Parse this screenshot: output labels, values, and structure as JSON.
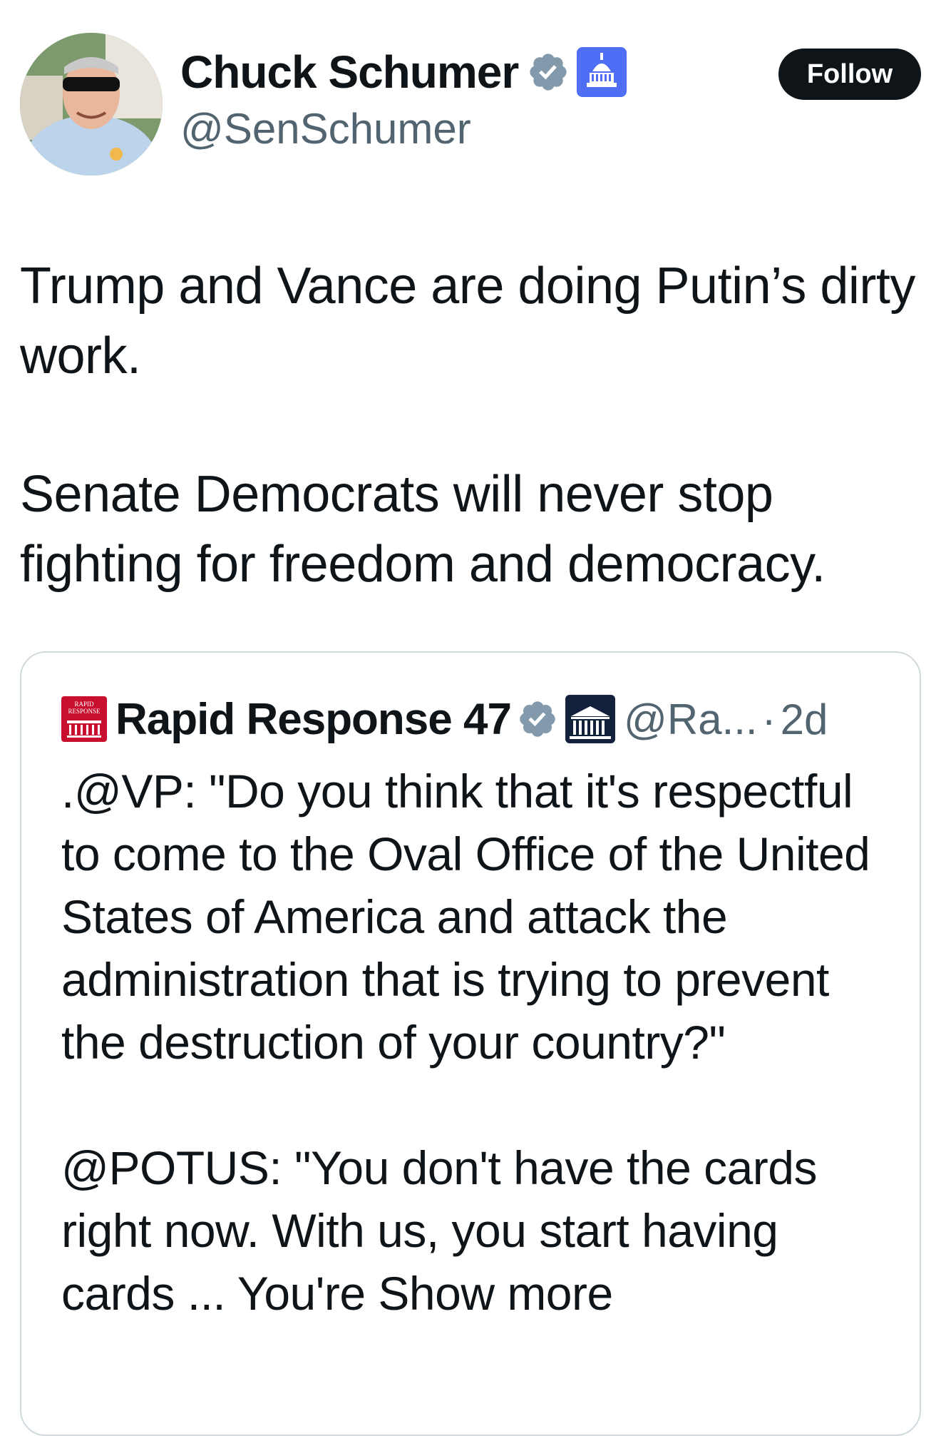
{
  "author": {
    "display_name": "Chuck Schumer",
    "handle": "@SenSchumer",
    "verified_badge_icon": "verified-check-icon",
    "affiliation_icon": "capitol-building-icon",
    "verified_color": "#829aab",
    "affiliation_color": "#4f6df5"
  },
  "follow_button": {
    "label": "Follow"
  },
  "tweet": {
    "paragraphs": [
      "Trump and Vance are doing Putin’s dirty work.",
      "Senate Democrats will never stop fighting for freedom and democracy."
    ]
  },
  "quote": {
    "avatar_lines": [
      "RAPID",
      "RESPONSE"
    ],
    "display_name": "Rapid Response 47",
    "verified_badge_icon": "verified-check-icon",
    "affiliation_icon": "white-house-icon",
    "handle": "@Ra...",
    "separator": "·",
    "time": "2d",
    "paragraphs": [
      ".@VP: \"Do you think that it's respectful to come to the Oval Office of the United States of America and attack the administration that is trying to prevent the destruction of your country?\"",
      "@POTUS: \"You don't have the cards right now. With us, you start having cards ... You're"
    ],
    "show_more": "Show more"
  }
}
